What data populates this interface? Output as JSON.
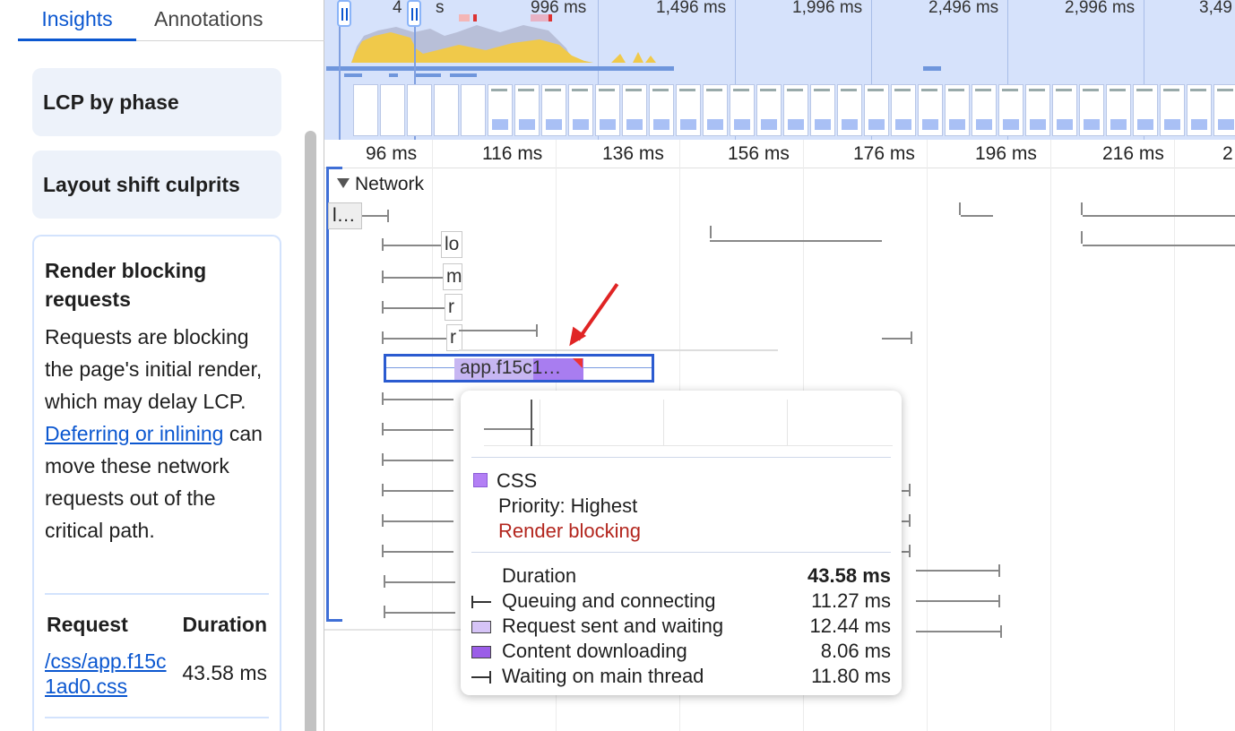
{
  "tabs": [
    {
      "label": "Insights",
      "active": true
    },
    {
      "label": "Annotations",
      "active": false
    }
  ],
  "insights": {
    "lcp_by_phase": "LCP by phase",
    "layout_shift": "Layout shift culprits",
    "render_blocking": {
      "title": "Render blocking requests",
      "body_1": "Requests are blocking the page's initial render, which may delay LCP.",
      "link": "Deferring or inlining",
      "body_2": "can move these network requests out of the critical path.",
      "col_request": "Request",
      "col_duration": "Duration",
      "rows": [
        {
          "request": "/css/app.f15c1ad0.css",
          "duration": "43.58 ms"
        }
      ]
    }
  },
  "overview": {
    "labels": [
      "4",
      "s",
      "996 ms",
      "1,496 ms",
      "1,996 ms",
      "2,496 ms",
      "2,996 ms",
      "3,49"
    ]
  },
  "ruler": {
    "labels": [
      "96 ms",
      "116 ms",
      "136 ms",
      "156 ms",
      "176 ms",
      "196 ms",
      "216 ms",
      "2"
    ]
  },
  "network": {
    "track_title": "Network",
    "first_label": "l…",
    "truncated_labels": [
      "lo",
      "m",
      "r",
      "r"
    ],
    "selected_request": "app.f15c1…"
  },
  "tooltip": {
    "category": "CSS",
    "priority": "Priority: Highest",
    "render_blocking": "Render blocking",
    "duration_label": "Duration",
    "duration_value": "43.58 ms",
    "phases": [
      {
        "icon": "queue-whisker-icon",
        "label": "Queuing and connecting",
        "value": "11.27 ms"
      },
      {
        "icon": "waiting-swatch-icon",
        "label": "Request sent and waiting",
        "value": "12.44 ms"
      },
      {
        "icon": "download-swatch-icon",
        "label": "Content downloading",
        "value": "8.06 ms"
      },
      {
        "icon": "main-thread-whisker-icon",
        "label": "Waiting on main thread",
        "value": "11.80 ms"
      }
    ]
  },
  "colors": {
    "accent": "#0b57d0",
    "selection_border": "#2b5bd0",
    "css_purple": "#a87df0",
    "render_blocking_red": "#b3261e",
    "annotation_arrow": "#e02424"
  }
}
